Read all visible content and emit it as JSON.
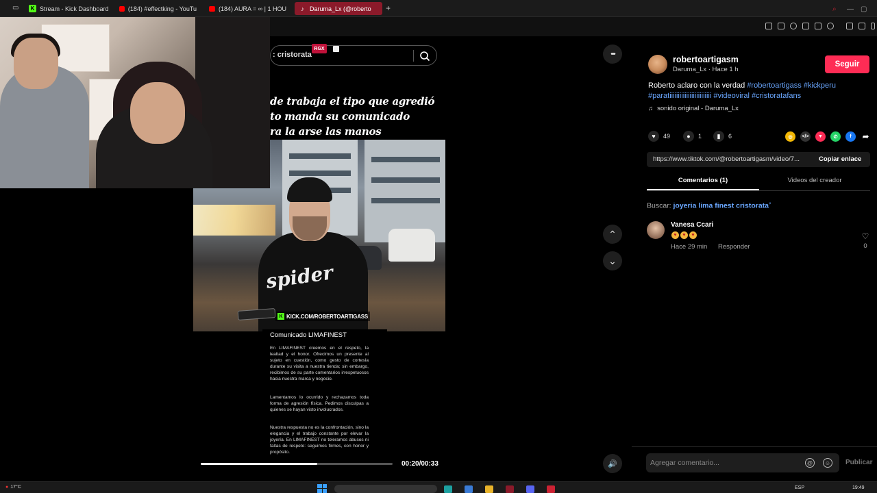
{
  "browser": {
    "tabs": [
      {
        "label": "Stream - Kick Dashboard",
        "favicon": "kick-icon"
      },
      {
        "label": "(184) #effectking - YouTu",
        "favicon": "youtube-icon"
      },
      {
        "label": "(184) AURA = ∞ | 1 HOU",
        "favicon": "youtube-icon"
      },
      {
        "label": "Daruma_Lx (@roberto",
        "favicon": "tiktok-icon",
        "active": true
      }
    ],
    "new_tab_label": "+"
  },
  "video": {
    "search_text": ": cristorata",
    "badge": "RGX",
    "caption_lines": [
      "de trabaja el tipo que agredió",
      "to manda su comunicado",
      "ra la arse las manos"
    ],
    "shirt_text": "spider",
    "kick_tag": "KICK.COM/ROBERTOARTIGASS",
    "statement_title": "Comunicado LIMAFINEST",
    "statement_paragraphs": [
      "En LIMAFINEST creemos en el respeto, la lealtad y el honor. Ofrecimos un presente al sujeto en cuestión, como gesto de cortesía durante su visita a nuestra tienda; sin embargo, recibimos de su parte comentarios irrespetuosos hacia nuestra marca y negocio.",
      "Lamentamos lo ocurrido y rechazamos toda forma de agresión física. Pedimos disculpas a quienes se hayan visto involucrados.",
      "Nuestra respuesta no es la confrontación, sino la elegancia y el trabajo constante por elevar la joyería. En LIMAFINEST no toleramos abusos ni faltas de respeto: seguimos firmes, con honor y propósito."
    ],
    "progress_fraction": 0.606,
    "time": "00:20/00:33"
  },
  "controls": {
    "more_icon": "•••",
    "up_icon": "⌃",
    "down_icon": "⌄",
    "volume_icon": "🔊"
  },
  "post": {
    "username": "robertoartigasm",
    "subline": "Daruma_Lx · Hace 1 h",
    "follow_label": "Seguir",
    "desc_text": "Roberto aclaro con la verdad ",
    "desc_tags": "#robertoartigass #kickperu #paratiiiiiiiiiiiiiiiiiiiiiiiii #videoviral #cristoratafans",
    "sound": "sonido original - Daruma_Lx",
    "likes": "49",
    "comments": "1",
    "saves": "6",
    "url": "https://www.tiktok.com/@robertoartigasm/video/7...",
    "copy_label": "Copiar enlace",
    "tab_comments": "Comentarios (1)",
    "tab_videos": "Videos del creador",
    "search_label": "Buscar: ",
    "search_query": "joyeria lima finest cristorata"
  },
  "comment": {
    "name": "Vanesa Ccari",
    "time": "Hace 29 min",
    "reply": "Responder",
    "like_count": "0"
  },
  "composer": {
    "placeholder": "Agregar comentario...",
    "publish_label": "Publicar"
  },
  "taskbar": {
    "weather": "17°C",
    "lang": "ESP",
    "clock": "19:49"
  }
}
